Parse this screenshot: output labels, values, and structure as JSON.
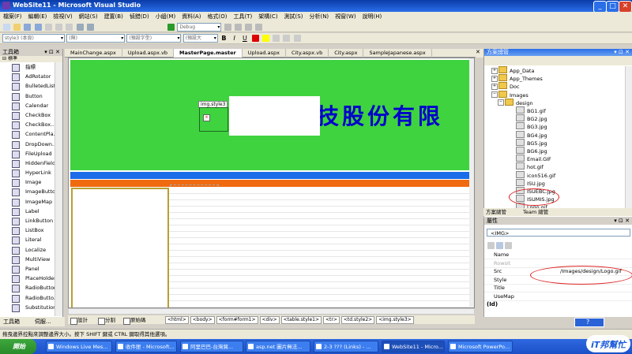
{
  "window": {
    "title": "WebSite11 - Microsoft Visual Studio"
  },
  "menu": [
    "檔案(F)",
    "編輯(E)",
    "檢視(V)",
    "網站(S)",
    "建置(B)",
    "偵錯(D)",
    "小組(M)",
    "資料(A)",
    "格式(O)",
    "工具(T)",
    "架構(C)",
    "測試(S)",
    "分析(N)",
    "視窗(W)",
    "說明(H)"
  ],
  "toolbar": {
    "config": "Debug",
    "style_combo": "style3 (本頁)",
    "font_combo": "(無)",
    "size_combo": "(預設字型)",
    "size2_combo": "(預設大"
  },
  "toolbox": {
    "title": "工具箱",
    "section": "標準",
    "items": [
      "指標",
      "AdRotator",
      "BulletedList",
      "Button",
      "Calendar",
      "CheckBox",
      "CheckBox...",
      "ContentPla...",
      "DropDown...",
      "FileUpload",
      "HiddenField",
      "HyperLink",
      "Image",
      "ImageButton",
      "ImageMap",
      "Label",
      "LinkButton",
      "ListBox",
      "Literal",
      "Localize",
      "MultiView",
      "Panel",
      "PlaceHolder",
      "RadioButton",
      "RadioButto...",
      "Substitution"
    ]
  },
  "doc_tabs": [
    "MainChange.aspx",
    "Upload.aspx.vb",
    "MasterPage.master",
    "Upload.aspx",
    "City.aspx.vb",
    "City.aspx",
    "SampleJapanese.aspx",
    "MainChange.aspx.vb"
  ],
  "design": {
    "banner_text": "技股份有限",
    "selected_tag": "img.style3",
    "image_marker": "×"
  },
  "view_tabs": {
    "design": "設計",
    "split": "分割",
    "source": "原始碼"
  },
  "breadcrumbs": [
    "<html>",
    "<body>",
    "<form#form1>",
    "<div>",
    "<table.style1>",
    "<tr>",
    "<td.style2>",
    "<img.style3>"
  ],
  "toolbox_tabs": {
    "toolbox": "工具箱",
    "server": "伺服..."
  },
  "solution_explorer": {
    "title": "方案總管",
    "nodes": [
      {
        "label": "App_Data",
        "type": "folder",
        "level": 1
      },
      {
        "label": "App_Themes",
        "type": "folder",
        "level": 1
      },
      {
        "label": "Doc",
        "type": "folder",
        "level": 1
      },
      {
        "label": "Images",
        "type": "folder",
        "level": 1
      },
      {
        "label": "design",
        "type": "folder",
        "level": 2
      },
      {
        "label": "BG1.gif",
        "type": "file",
        "level": 3
      },
      {
        "label": "BG2.jpg",
        "type": "file",
        "level": 3
      },
      {
        "label": "BG3.jpg",
        "type": "file",
        "level": 3
      },
      {
        "label": "BG4.jpg",
        "type": "file",
        "level": 3
      },
      {
        "label": "BG5.jpg",
        "type": "file",
        "level": 3
      },
      {
        "label": "BG6.jpg",
        "type": "file",
        "level": 3
      },
      {
        "label": "Email.GIF",
        "type": "file",
        "level": 3
      },
      {
        "label": "hot.gif",
        "type": "file",
        "level": 3
      },
      {
        "label": "icon516.gif",
        "type": "file",
        "level": 3
      },
      {
        "label": "ISU.jpg",
        "type": "file",
        "level": 3
      },
      {
        "label": "ISUEBC.jpg",
        "type": "file",
        "level": 3
      },
      {
        "label": "ISUMIS.jpg",
        "type": "file",
        "level": 3
      },
      {
        "label": "Logo.gif",
        "type": "file",
        "level": 3
      }
    ],
    "tabs": [
      "方案總管",
      "Team 總管"
    ]
  },
  "properties": {
    "title": "屬性",
    "object": "<IMG>",
    "rows": [
      {
        "key": "Name",
        "value": ""
      },
      {
        "key": "RowsIt",
        "value": ""
      },
      {
        "key": "Src",
        "value": "/Images/design/Logo.gif"
      },
      {
        "key": "Style",
        "value": ""
      },
      {
        "key": "Title",
        "value": ""
      },
      {
        "key": "UseMap",
        "value": ""
      }
    ],
    "footer": "(Id)"
  },
  "statusbar": {
    "text": "拖曳邊界控點來調整邊界大小。按下 SHIFT 鍵或 CTRL 鍵取得其他選項。"
  },
  "taskbar": {
    "start": "開始",
    "tasks": [
      "Windows Live Mes...",
      "收件匣 - Microsoft...",
      "阿里巴巴-台灣貿...",
      "asp.net 圖片無法...",
      "2-3 ??? (Links) - ...",
      "WebSite11 - Micro...",
      "Microsoft PowerPo..."
    ],
    "help_label": "?",
    "brand": "iT邦幫忙"
  },
  "colors": {
    "banner_green": "#3fd33f",
    "banner_text": "#0000cc",
    "blue_bar": "#1a6ce8",
    "orange_bar": "#f06a10",
    "ellipse": "#dd2222"
  }
}
